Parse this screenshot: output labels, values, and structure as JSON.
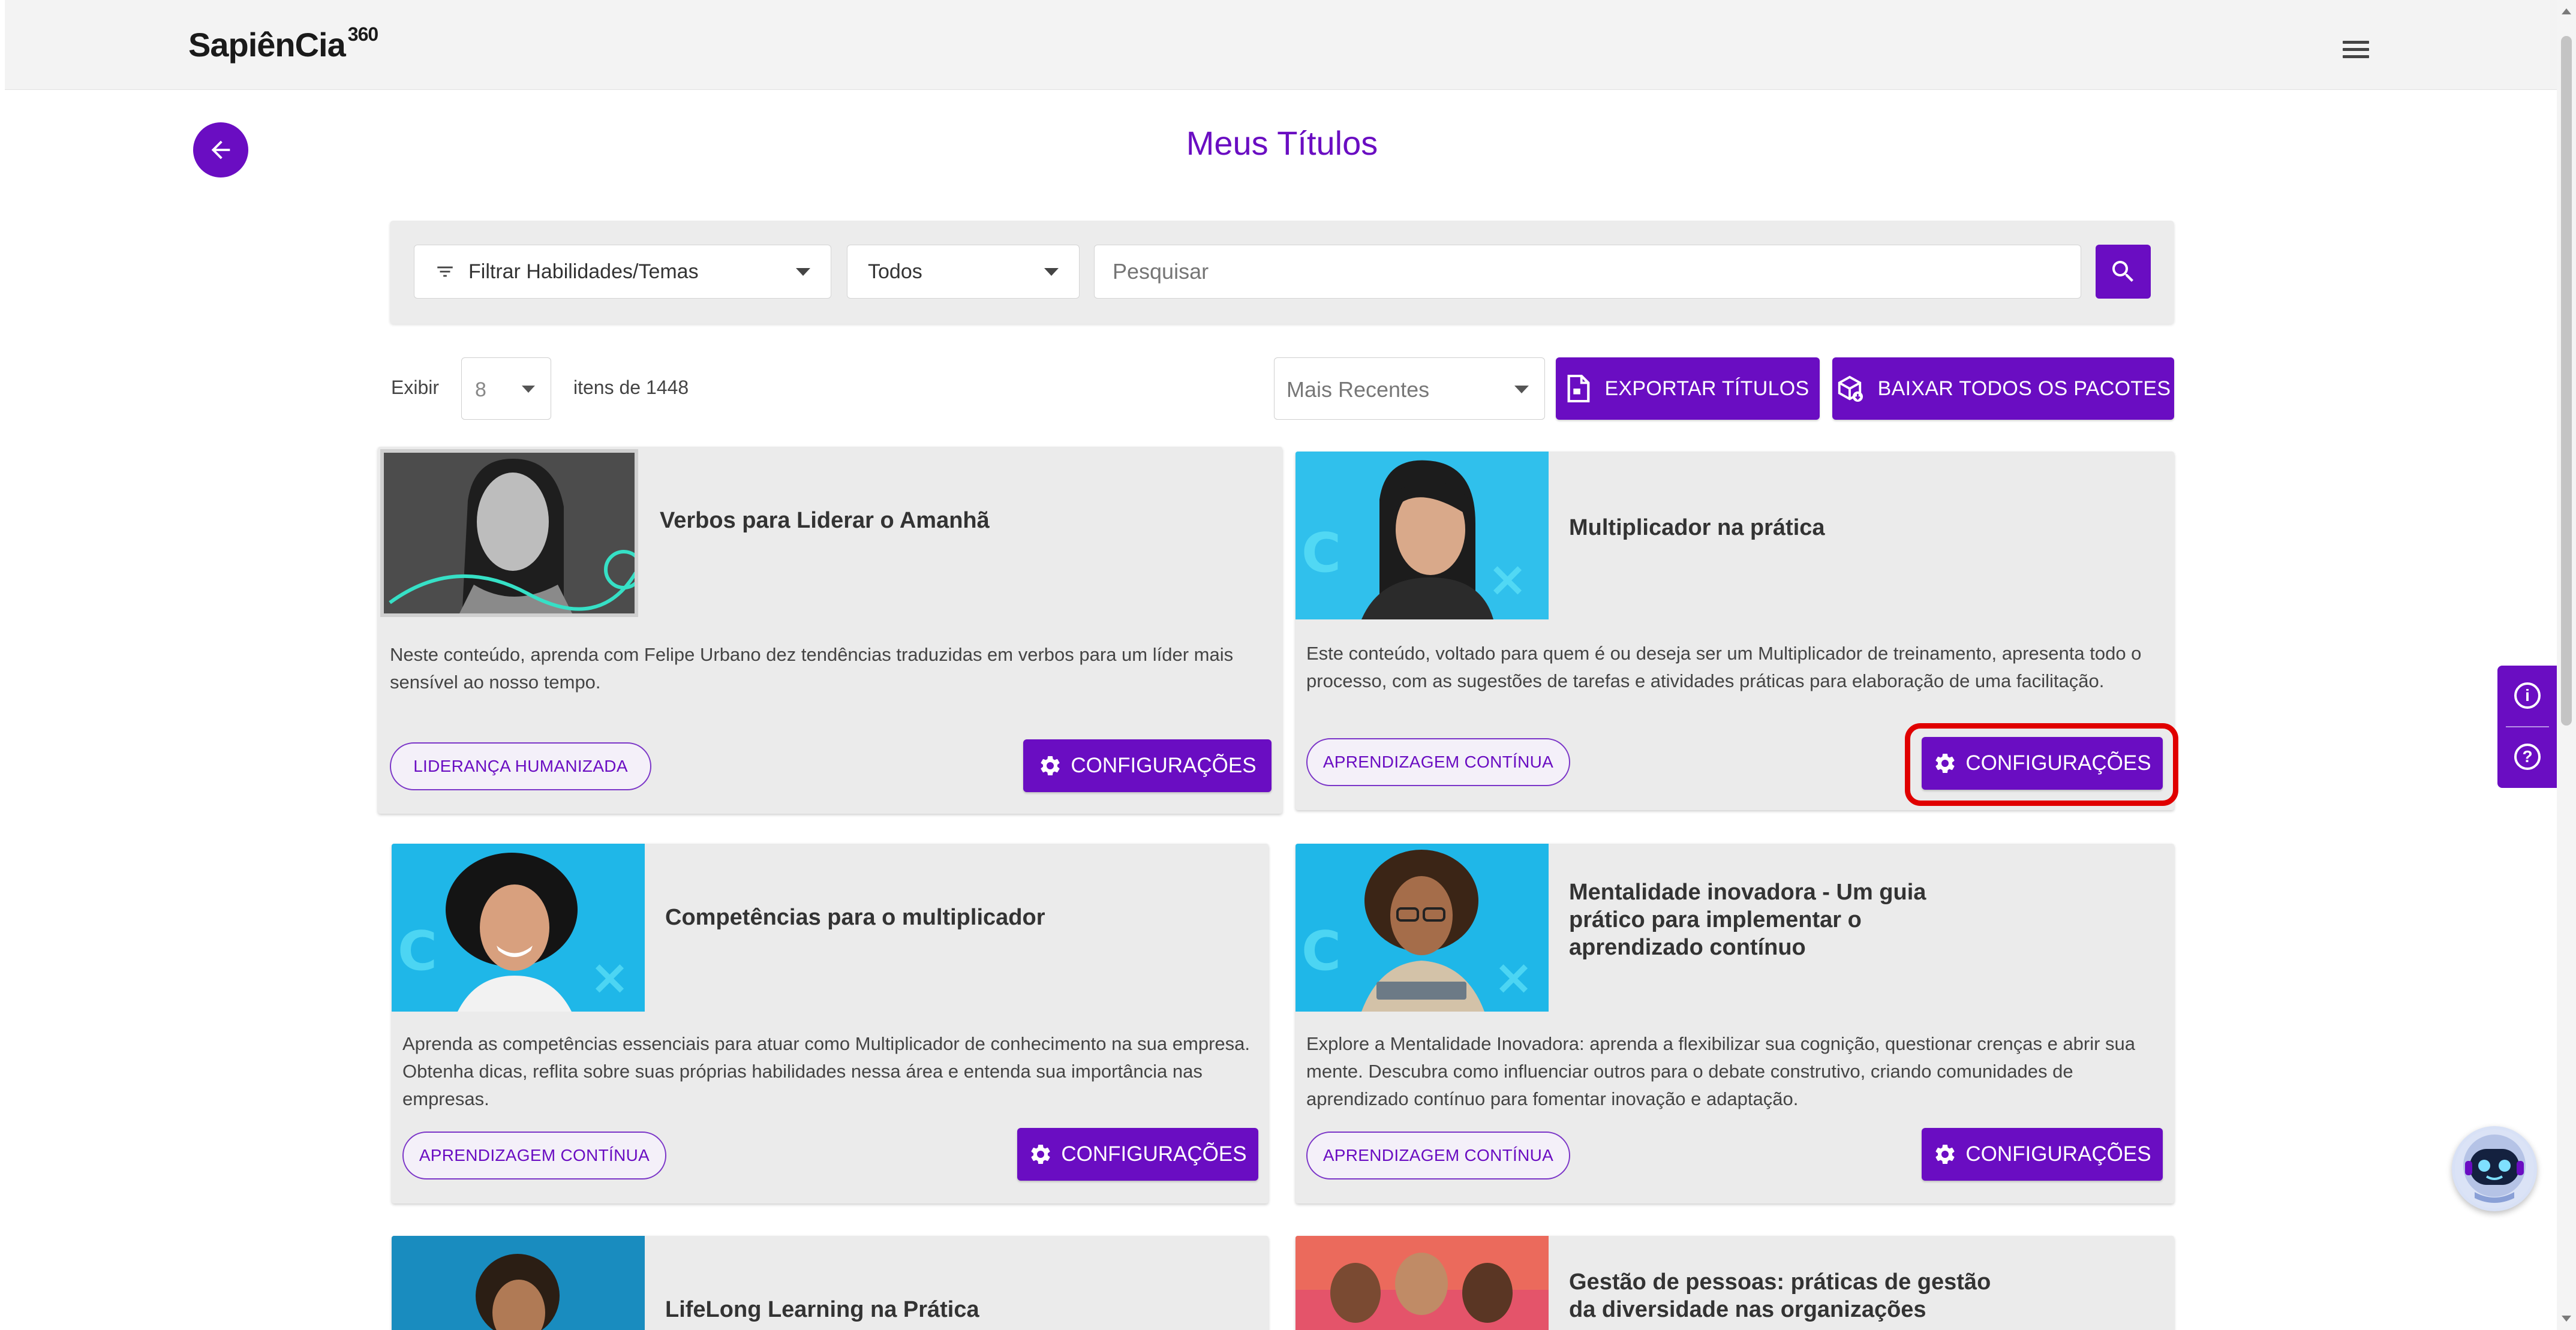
{
  "header": {
    "logo": "SapiênCia",
    "logo_sup": "360",
    "menu_icon": "hamburger-icon"
  },
  "page": {
    "title": "Meus Títulos"
  },
  "filters": {
    "skills_filter": "Filtrar Habilidades/Temas",
    "status_select": "Todos",
    "search_placeholder": "Pesquisar"
  },
  "toolbar": {
    "exibir_label": "Exibir",
    "per_page": "8",
    "items_count": "itens de 1448",
    "sort": "Mais Recentes",
    "export_label": "EXPORTAR TÍTULOS",
    "download_label": "BAIXAR TODOS OS PACOTES"
  },
  "cards": [
    {
      "title": "Verbos para Liderar o Amanhã",
      "description": "Neste conteúdo, aprenda com Felipe Urbano dez tendências traduzidas em verbos para um líder mais sensível ao nosso tempo.",
      "desc_lines": [
        "Neste conteúdo, aprenda com Felipe Urbano dez tendências traduzidas em verbos para um líder mais",
        "sensível ao nosso tempo."
      ],
      "tag": "LIDERANÇA HUMANIZADA",
      "button": "CONFIGURAÇÕES"
    },
    {
      "title": "Multiplicador na prática",
      "description": "Este conteúdo, voltado para quem é ou deseja ser um Multiplicador de treinamento, apresenta todo o processo, com as sugestões de tarefas e atividades práticas para elaboração de uma facilitação.",
      "desc_lines": [
        "Este conteúdo, voltado para quem é ou deseja ser um Multiplicador de treinamento, apresenta todo o",
        "processo, com as sugestões de tarefas e atividades práticas para elaboração de uma facilitação."
      ],
      "tag": "APRENDIZAGEM CONTÍNUA",
      "button": "CONFIGURAÇÕES"
    },
    {
      "title": "Competências para o multiplicador",
      "description": "Aprenda as competências essenciais para atuar como Multiplicador de conhecimento na sua empresa. Obtenha dicas, reflita sobre suas próprias habilidades nessa área e entenda sua importância nas empresas.",
      "desc_lines": [
        "Aprenda as competências essenciais para atuar como Multiplicador de conhecimento na sua empresa.",
        "Obtenha dicas, reflita sobre suas próprias habilidades nessa área e entenda sua importância nas",
        "empresas."
      ],
      "tag": "APRENDIZAGEM CONTÍNUA",
      "button": "CONFIGURAÇÕES"
    },
    {
      "title": "Mentalidade inovadora - Um guia prático para implementar o aprendizado contínuo",
      "title_lines": [
        "Mentalidade inovadora - Um guia",
        "prático para implementar o",
        "aprendizado contínuo"
      ],
      "description": "Explore a Mentalidade Inovadora: aprenda a flexibilizar sua cognição, questionar crenças e abrir sua mente. Descubra como influenciar outros para o debate construtivo, criando comunidades de aprendizado contínuo para fomentar inovação e adaptação.",
      "desc_lines": [
        "Explore a Mentalidade Inovadora: aprenda a flexibilizar sua cognição, questionar crenças e abrir sua",
        "mente. Descubra como influenciar outros para o debate construtivo, criando comunidades de",
        "aprendizado contínuo para fomentar inovação e adaptação."
      ],
      "tag": "APRENDIZAGEM CONTÍNUA",
      "button": "CONFIGURAÇÕES"
    },
    {
      "title": "LifeLong Learning na Prática"
    },
    {
      "title": "Gestão de pessoas: práticas de gestão da diversidade nas organizações",
      "title_lines": [
        "Gestão de pessoas: práticas de gestão",
        "da diversidade nas organizações"
      ]
    }
  ],
  "side_widget": {
    "info_icon": "i",
    "help_icon": "?"
  },
  "colors": {
    "primary": "#6a0dc2",
    "highlight": "#e00000",
    "card_bg": "#ebebeb",
    "teal_thumb": "#1fb7e8"
  }
}
